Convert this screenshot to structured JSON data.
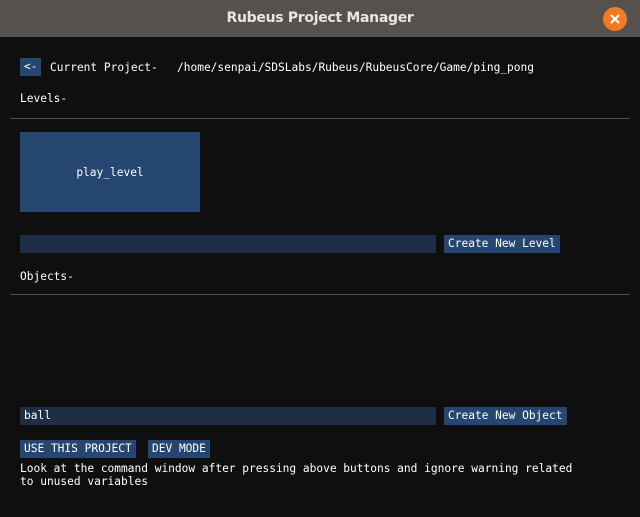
{
  "window": {
    "title": "Rubeus Project Manager",
    "close_icon": "close-icon",
    "close_color": "#f37a20"
  },
  "header": {
    "back_label": "<-",
    "current_project_label": "Current Project-",
    "project_path": "/home/senpai/SDSLabs/Rubeus/RubeusCore/Game/ping_pong"
  },
  "levels": {
    "heading": "Levels-",
    "items": [
      {
        "label": "play_level"
      }
    ],
    "new_level_input_value": "",
    "create_button_label": "Create New Level"
  },
  "objects": {
    "heading": "Objects-",
    "items": [],
    "new_object_input_value": "ball",
    "create_button_label": "Create New Object"
  },
  "actions": {
    "use_project_label": "USE THIS PROJECT",
    "dev_mode_label": "DEV MODE"
  },
  "hint": {
    "line1": "Look at the command window after pressing above buttons and ignore warning related",
    "line2": "to unused variables"
  },
  "colors": {
    "accent": "#244670",
    "input_bg": "#1e2e47",
    "background": "#0f0f0f",
    "titlebar": "#57514d"
  }
}
